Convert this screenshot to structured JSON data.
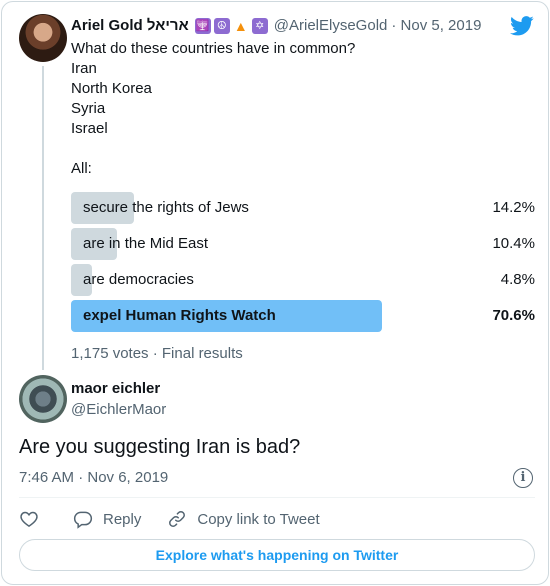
{
  "tweet": {
    "author": {
      "display_name": "Ariel Gold אריאל",
      "emojis": [
        "menorah-emoji",
        "peace-emoji",
        "fire-emoji",
        "star-of-david-emoji"
      ],
      "handle": "@ArielElyseGold",
      "date": "· Nov 5, 2019"
    },
    "text_lines": [
      "What do these countries have in common?",
      "Iran",
      "North Korea",
      "Syria",
      "Israel",
      "",
      "All:"
    ],
    "poll": {
      "options": [
        {
          "label": "secure the rights of Jews",
          "percent": "14.2%",
          "value": 14.2,
          "winner": false
        },
        {
          "label": "are in the Mid East",
          "percent": "10.4%",
          "value": 10.4,
          "winner": false
        },
        {
          "label": "are democracies",
          "percent": "4.8%",
          "value": 4.8,
          "winner": false
        },
        {
          "label": "expel Human Rights Watch",
          "percent": "70.6%",
          "value": 70.6,
          "winner": true
        }
      ],
      "meta": "1,175 votes · Final results"
    }
  },
  "reply": {
    "display_name": "maor eichler",
    "handle": "@EichlerMaor",
    "text": "Are you suggesting Iran is bad?",
    "timestamp": "7:46 AM · Nov 6, 2019",
    "actions": {
      "reply_label": "Reply",
      "copy_label": "Copy link to Tweet"
    }
  },
  "explore_label": "Explore what's happening on Twitter",
  "colors": {
    "accent": "#1d9bf0",
    "poll_winner": "#71bff7",
    "poll_other": "#cfd9de",
    "secondary_text": "#536471"
  }
}
